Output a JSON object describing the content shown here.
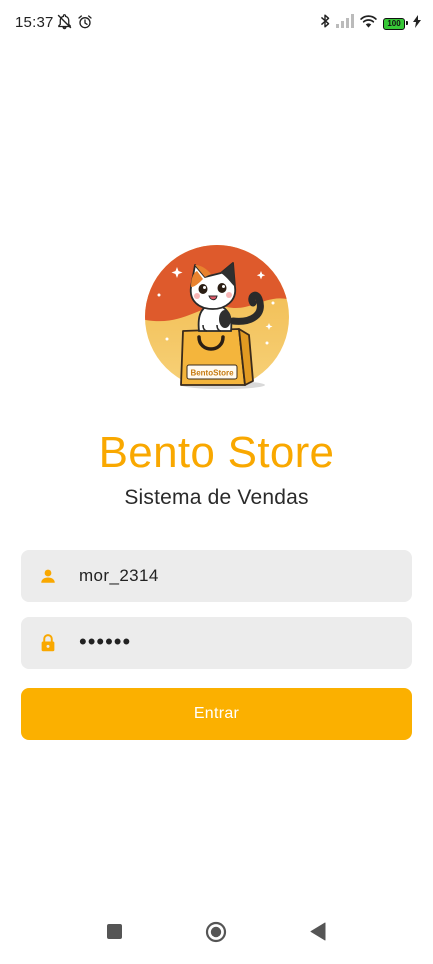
{
  "status_bar": {
    "time": "15:37",
    "battery_level": "100",
    "icons": [
      "notifications-off-icon",
      "alarm-icon",
      "bluetooth-icon",
      "signal-icon",
      "wifi-icon",
      "battery-icon",
      "charging-icon"
    ]
  },
  "logo": {
    "bag_text": "BentoStore"
  },
  "brand": {
    "title": "Bento Store",
    "subtitle": "Sistema de Vendas"
  },
  "login_form": {
    "username": {
      "value": "mor_2314",
      "icon": "person-icon"
    },
    "password": {
      "value": "••••••",
      "icon": "lock-icon"
    },
    "submit_label": "Entrar"
  },
  "nav_bar": {
    "buttons": [
      "recents-button",
      "home-button",
      "back-button"
    ]
  },
  "colors": {
    "accent": "#FBB000",
    "title": "#F9A800",
    "field_bg": "#ECECEC",
    "logo_top": "#E05A2B",
    "logo_bottom": "#F2C14E"
  }
}
